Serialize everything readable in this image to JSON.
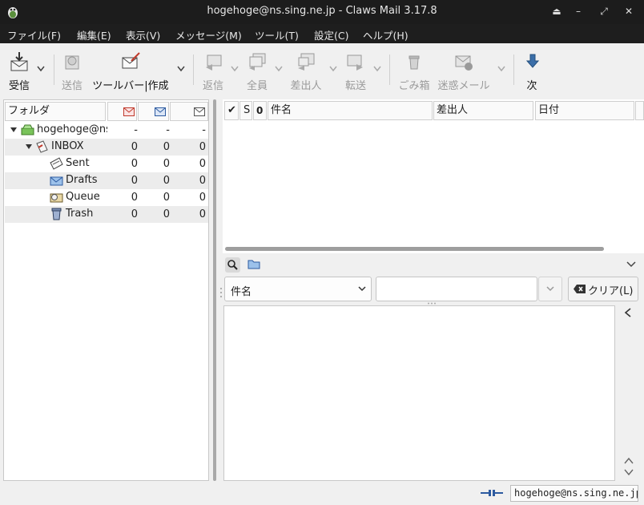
{
  "window": {
    "title": "hogehoge@ns.sing.ne.jp - Claws Mail 3.17.8",
    "buttons": [
      "⏏",
      "–",
      "⤢",
      "✕"
    ]
  },
  "menubar": [
    "ファイル(F)",
    "編集(E)",
    "表示(V)",
    "メッセージ(M)",
    "ツール(T)",
    "設定(C)",
    "ヘルプ(H)"
  ],
  "toolbar": {
    "receive": "受信",
    "send": "送信",
    "compose": "ツールバー|作成",
    "reply": "返信",
    "reply_all": "全員",
    "reply_sender": "差出人",
    "forward": "転送",
    "trash": "ごみ箱",
    "spam": "迷惑メール",
    "next": "次"
  },
  "folders": {
    "header": "フォルダ",
    "rows": [
      {
        "name": "hogehoge@ns",
        "new": "-",
        "unread": "-",
        "total": "-"
      },
      {
        "name": "INBOX",
        "new": "0",
        "unread": "0",
        "total": "0"
      },
      {
        "name": "Sent",
        "new": "0",
        "unread": "0",
        "total": "0"
      },
      {
        "name": "Drafts",
        "new": "0",
        "unread": "0",
        "total": "0"
      },
      {
        "name": "Queue",
        "new": "0",
        "unread": "0",
        "total": "0"
      },
      {
        "name": "Trash",
        "new": "0",
        "unread": "0",
        "total": "0"
      }
    ]
  },
  "messages": {
    "columns": {
      "check": "✔",
      "s": "S",
      "attach": "0",
      "subject": "件名",
      "from": "差出人",
      "date": "日付"
    },
    "rows": []
  },
  "search": {
    "field_selected": "件名",
    "value": "",
    "clear_label": "クリア(L)"
  },
  "status": {
    "account": "hogehoge@ns.sing.ne.jp"
  },
  "colors": {
    "titlebar": "#1c1c1c",
    "window_bg": "#f0f0f0",
    "folder_alt_row": "#ececec"
  }
}
